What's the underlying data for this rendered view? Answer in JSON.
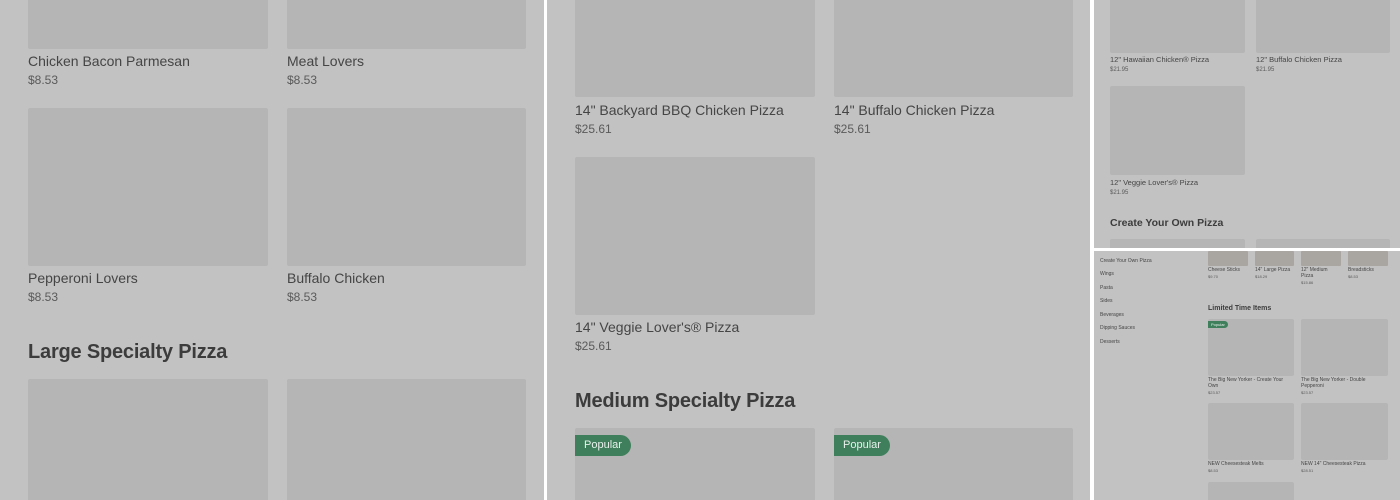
{
  "panel1": {
    "items_top": [
      {
        "name": "Chicken Bacon Parmesan",
        "price": "$8.53"
      },
      {
        "name": "Meat Lovers",
        "price": "$8.53"
      },
      {
        "name": "Pepperoni Lovers",
        "price": "$8.53"
      },
      {
        "name": "Buffalo Chicken",
        "price": "$8.53"
      }
    ],
    "section_title": "Large Specialty Pizza"
  },
  "panel2": {
    "items": [
      {
        "name": "14\" Backyard BBQ Chicken Pizza",
        "price": "$25.61"
      },
      {
        "name": "14\" Buffalo Chicken Pizza",
        "price": "$25.61"
      },
      {
        "name": "14\" Veggie Lover's® Pizza",
        "price": "$25.61"
      }
    ],
    "section_title": "Medium Specialty Pizza",
    "badges": [
      "Popular",
      "Popular"
    ]
  },
  "panel3": {
    "items": [
      {
        "name": "12\" Hawaiian Chicken® Pizza",
        "price": "$21.95"
      },
      {
        "name": "12\" Buffalo Chicken Pizza",
        "price": "$21.95"
      },
      {
        "name": "12\" Veggie Lover's® Pizza",
        "price": "$21.95"
      }
    ],
    "section_title": "Create Your Own Pizza"
  },
  "panel4": {
    "nav": [
      "Create Your Own Pizza",
      "Wings",
      "Pasta",
      "Sides",
      "Beverages",
      "Dipping Sauces",
      "Desserts"
    ],
    "top_items": [
      {
        "name": "Cheese Sticks",
        "price": "$9.70"
      },
      {
        "name": "14\" Large Pizza",
        "price": "$18.29"
      },
      {
        "name": "12\" Medium Pizza",
        "price": "$15.86"
      },
      {
        "name": "Breadsticks",
        "price": "$8.53"
      }
    ],
    "section_title": "Limited Time Items",
    "badge": "Popular",
    "items": [
      {
        "name": "The Big New Yorker - Create Your Own",
        "price": "$23.57"
      },
      {
        "name": "The Big New Yorker - Double Pepperoni",
        "price": "$23.57"
      },
      {
        "name": "NEW Cheesesteak Melts",
        "price": "$8.53"
      },
      {
        "name": "NEW 14\" Cheesesteak Pizza",
        "price": "$28.51"
      }
    ]
  },
  "colors": {
    "overlay_bg": "#c2c2c2",
    "placeholder": "#b5b5b5",
    "badge_green": "#3f7f5c"
  }
}
